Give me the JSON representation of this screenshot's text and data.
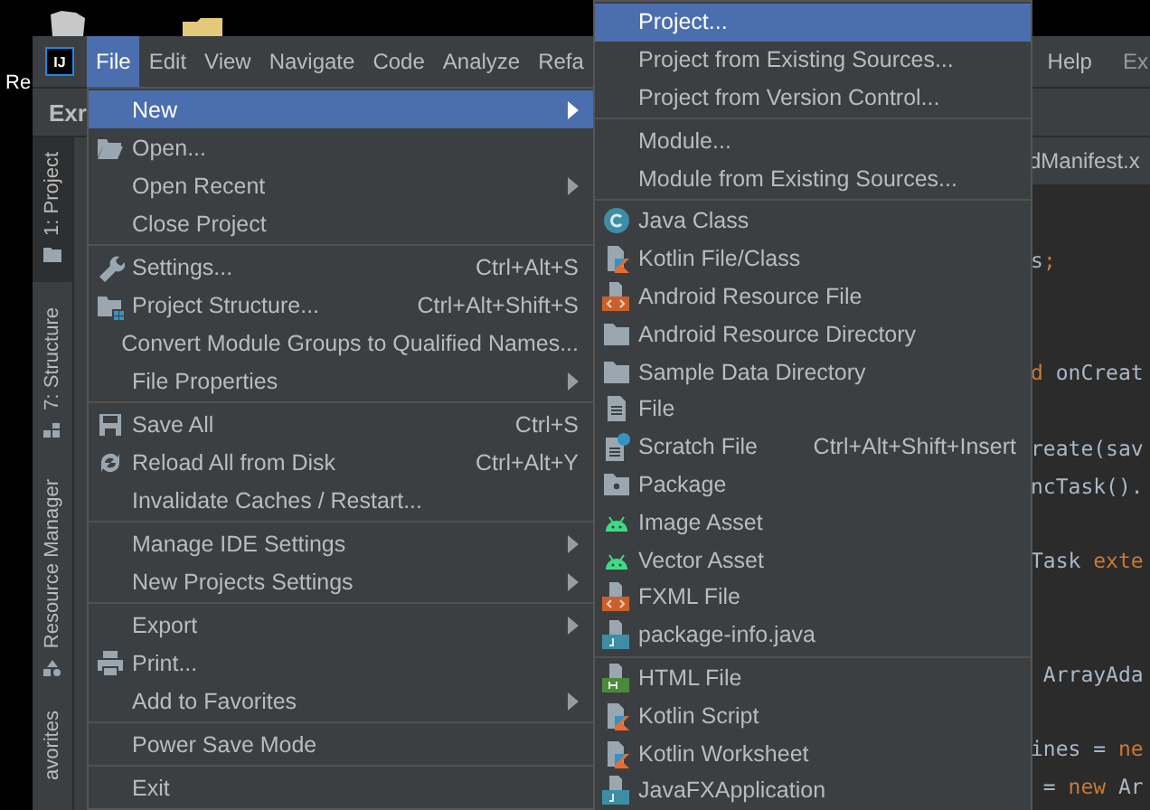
{
  "desktop": {
    "label": "Re"
  },
  "menubar": {
    "logo": "IJ",
    "items": [
      {
        "label": "File",
        "selected": true
      },
      {
        "label": "Edit",
        "selected": false
      },
      {
        "label": "View",
        "selected": false
      },
      {
        "label": "Navigate",
        "selected": false
      },
      {
        "label": "Code",
        "selected": false
      },
      {
        "label": "Analyze",
        "selected": false
      },
      {
        "label": "Refa",
        "selected": false
      }
    ],
    "right_items": [
      {
        "label": "Help",
        "selected": false
      }
    ],
    "title": "Ex"
  },
  "navbar": {
    "project": "Exr"
  },
  "tool_strip": [
    {
      "label": "1: Project",
      "selected": true
    },
    {
      "label": "7: Structure",
      "selected": false
    },
    {
      "label": "Resource Manager",
      "selected": false
    },
    {
      "label": "avorites",
      "selected": false
    }
  ],
  "editor": {
    "tab": "dManifest.x",
    "lines": [
      {
        "kind": "code",
        "segments": [
          {
            "text": "s",
            "kind": "plain"
          },
          {
            "text": ";",
            "kind": "keyword"
          }
        ]
      },
      {
        "kind": "blank"
      },
      {
        "kind": "blank"
      },
      {
        "kind": "code",
        "segments": [
          {
            "text": "d",
            "kind": "keyword"
          },
          {
            "text": " onCreat",
            "kind": "plain"
          }
        ]
      },
      {
        "kind": "blank"
      },
      {
        "kind": "code",
        "segments": [
          {
            "text": "reate(sav",
            "kind": "plain"
          }
        ]
      },
      {
        "kind": "code",
        "segments": [
          {
            "text": "ncTask().",
            "kind": "plain"
          }
        ]
      },
      {
        "kind": "blank"
      },
      {
        "kind": "code",
        "segments": [
          {
            "text": "Task ",
            "kind": "plain"
          },
          {
            "text": "exte",
            "kind": "keyword"
          }
        ]
      },
      {
        "kind": "blank"
      },
      {
        "kind": "blank"
      },
      {
        "kind": "code",
        "segments": [
          {
            "text": " ArrayAda",
            "kind": "plain"
          }
        ]
      },
      {
        "kind": "blank"
      },
      {
        "kind": "code",
        "segments": [
          {
            "text": "ines = ",
            "kind": "plain"
          },
          {
            "text": "ne",
            "kind": "keyword"
          }
        ]
      },
      {
        "kind": "code",
        "segments": [
          {
            "text": " = ",
            "kind": "plain"
          },
          {
            "text": "new",
            "kind": "keyword"
          },
          {
            "text": " Ar",
            "kind": "plain"
          }
        ]
      }
    ]
  },
  "file_menu": {
    "groups": [
      [
        {
          "label": "New",
          "submenu": true,
          "selected": true
        },
        {
          "label": "Open...",
          "submenu": false,
          "selected": false
        },
        {
          "label": "Open Recent",
          "submenu": true,
          "selected": false
        },
        {
          "label": "Close Project",
          "submenu": false,
          "selected": false
        }
      ],
      [
        {
          "label": "Settings...",
          "shortcut": "Ctrl+Alt+S",
          "submenu": false,
          "selected": false
        },
        {
          "label": "Project Structure...",
          "shortcut": "Ctrl+Alt+Shift+S",
          "submenu": false,
          "selected": false
        },
        {
          "label": "Convert Module Groups to Qualified Names...",
          "submenu": false,
          "selected": false
        },
        {
          "label": "File Properties",
          "submenu": true,
          "selected": false
        }
      ],
      [
        {
          "label": "Save All",
          "shortcut": "Ctrl+S",
          "submenu": false,
          "selected": false
        },
        {
          "label": "Reload All from Disk",
          "shortcut": "Ctrl+Alt+Y",
          "submenu": false,
          "selected": false
        },
        {
          "label": "Invalidate Caches / Restart...",
          "submenu": false,
          "selected": false
        }
      ],
      [
        {
          "label": "Manage IDE Settings",
          "submenu": true,
          "selected": false
        },
        {
          "label": "New Projects Settings",
          "submenu": true,
          "selected": false
        }
      ],
      [
        {
          "label": "Export",
          "submenu": true,
          "selected": false
        },
        {
          "label": "Print...",
          "submenu": false,
          "selected": false
        },
        {
          "label": "Add to Favorites",
          "submenu": true,
          "selected": false
        }
      ],
      [
        {
          "label": "Power Save Mode",
          "submenu": false,
          "selected": false
        }
      ],
      [
        {
          "label": "Exit",
          "submenu": false,
          "selected": false
        }
      ]
    ]
  },
  "new_menu": {
    "groups": [
      [
        {
          "label": "Project...",
          "selected": true
        },
        {
          "label": "Project from Existing Sources...",
          "selected": false
        },
        {
          "label": "Project from Version Control...",
          "selected": false
        }
      ],
      [
        {
          "label": "Module...",
          "selected": false
        },
        {
          "label": "Module from Existing Sources...",
          "selected": false
        }
      ],
      [
        {
          "label": "Java Class",
          "selected": false
        },
        {
          "label": "Kotlin File/Class",
          "selected": false
        },
        {
          "label": "Android Resource File",
          "selected": false
        },
        {
          "label": "Android Resource Directory",
          "selected": false
        },
        {
          "label": "Sample Data Directory",
          "selected": false
        },
        {
          "label": "File",
          "selected": false
        },
        {
          "label": "Scratch File",
          "shortcut": "Ctrl+Alt+Shift+Insert",
          "selected": false
        },
        {
          "label": "Package",
          "selected": false
        },
        {
          "label": "Image Asset",
          "selected": false
        },
        {
          "label": "Vector Asset",
          "selected": false
        },
        {
          "label": "FXML File",
          "selected": false
        },
        {
          "label": "package-info.java",
          "selected": false
        }
      ],
      [
        {
          "label": "HTML File",
          "selected": false
        },
        {
          "label": "Kotlin Script",
          "selected": false
        },
        {
          "label": "Kotlin Worksheet",
          "selected": false
        },
        {
          "label": "JavaFXApplication",
          "selected": false
        }
      ]
    ]
  }
}
